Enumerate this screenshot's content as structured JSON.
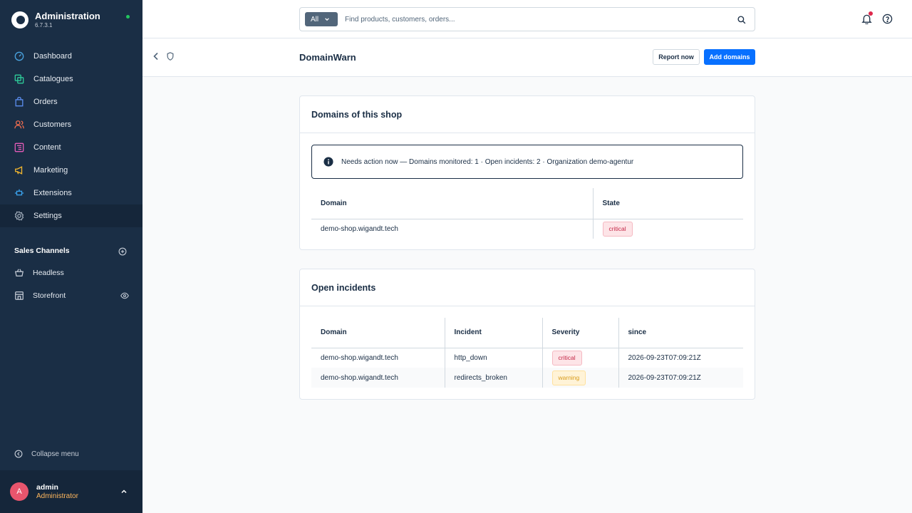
{
  "app": {
    "title": "Administration",
    "version": "6.7.3.1"
  },
  "nav": [
    {
      "label": "Dashboard",
      "icon": "dashboard-icon",
      "color": "#4aa3df"
    },
    {
      "label": "Catalogues",
      "icon": "catalogue-icon",
      "color": "#2ecc9a"
    },
    {
      "label": "Orders",
      "icon": "orders-icon",
      "color": "#5b8def"
    },
    {
      "label": "Customers",
      "icon": "customers-icon",
      "color": "#f26d4f"
    },
    {
      "label": "Content",
      "icon": "content-icon",
      "color": "#e35bb8"
    },
    {
      "label": "Marketing",
      "icon": "marketing-icon",
      "color": "#f5b82e"
    },
    {
      "label": "Extensions",
      "icon": "extensions-icon",
      "color": "#3ba4f0"
    },
    {
      "label": "Settings",
      "icon": "settings-icon",
      "color": "#9aa6b4"
    }
  ],
  "sales_channels": {
    "title": "Sales Channels",
    "items": [
      {
        "label": "Headless",
        "icon": "basket-icon"
      },
      {
        "label": "Storefront",
        "icon": "storefront-icon"
      }
    ]
  },
  "collapse_label": "Collapse menu",
  "user": {
    "initial": "A",
    "name": "admin",
    "role": "Administrator"
  },
  "search": {
    "type": "All",
    "placeholder": "Find products, customers, orders..."
  },
  "page": {
    "title": "DomainWarn",
    "report_button": "Report now",
    "add_button": "Add domains"
  },
  "domains_card": {
    "title": "Domains of this shop",
    "alert": "Needs action now — Domains monitored: 1 · Open incidents: 2 · Organization demo-agentur",
    "columns": [
      "Domain",
      "State"
    ],
    "rows": [
      {
        "domain": "demo-shop.wigandt.tech",
        "state": "critical"
      }
    ]
  },
  "incidents_card": {
    "title": "Open incidents",
    "columns": [
      "Domain",
      "Incident",
      "Severity",
      "since"
    ],
    "rows": [
      {
        "domain": "demo-shop.wigandt.tech",
        "incident": "http_down",
        "severity": "critical",
        "since": "2026-09-23T07:09:21Z"
      },
      {
        "domain": "demo-shop.wigandt.tech",
        "incident": "redirects_broken",
        "severity": "warning",
        "since": "2026-09-23T07:09:21Z"
      }
    ]
  },
  "colors": {
    "sidebar": "#1a2e45",
    "primary": "#0870ff",
    "critical": "#c42545",
    "warning": "#d89b1b"
  }
}
